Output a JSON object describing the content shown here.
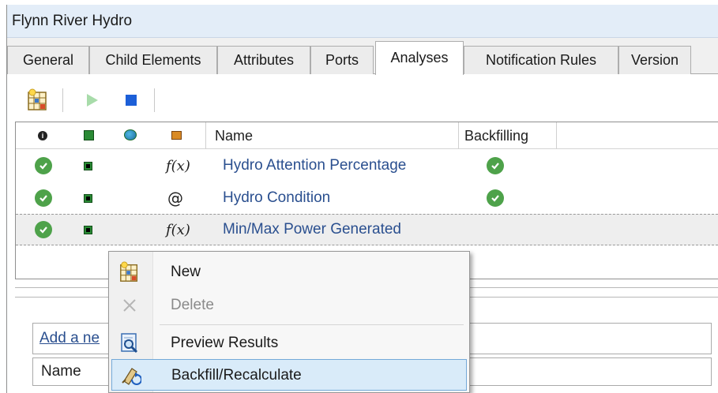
{
  "window": {
    "title": "Flynn River Hydro"
  },
  "tabs": [
    {
      "label": "General",
      "active": false
    },
    {
      "label": "Child Elements",
      "active": false
    },
    {
      "label": "Attributes",
      "active": false
    },
    {
      "label": "Ports",
      "active": false
    },
    {
      "label": "Analyses",
      "active": true
    },
    {
      "label": "Notification Rules",
      "active": false
    },
    {
      "label": "Version",
      "active": false
    }
  ],
  "toolbar": {
    "buttons": [
      {
        "icon": "new-analysis-icon",
        "enabled": true
      },
      {
        "icon": "play-icon",
        "enabled": false
      },
      {
        "icon": "stop-icon",
        "enabled": true
      }
    ]
  },
  "analyses_grid": {
    "header_icons": [
      "info-icon",
      "status-icon",
      "globe-icon",
      "type-icon"
    ],
    "columns": {
      "name": "Name",
      "backfilling": "Backfilling"
    },
    "rows": [
      {
        "status": "check-icon",
        "type": "fx",
        "name": "Hydro Attention Percentage",
        "backfilling": true
      },
      {
        "status": "check-icon",
        "type": "event",
        "name": "Hydro Condition",
        "backfilling": true
      },
      {
        "status": "check-icon",
        "type": "fx",
        "name": "Min/Max Power Generated",
        "backfilling": false
      }
    ],
    "type_glyphs": {
      "fx": "f(x)",
      "event": "@"
    }
  },
  "lower_panel": {
    "add_placeholder": "Add a ne",
    "name_header": "Name"
  },
  "context_menu": {
    "items": [
      {
        "label": "New",
        "icon": "new-analysis-icon",
        "enabled": true,
        "highlighted": false
      },
      {
        "label": "Delete",
        "icon": "delete-icon",
        "enabled": false,
        "highlighted": false
      },
      {
        "label": "Preview Results",
        "icon": "preview-icon",
        "enabled": true,
        "highlighted": false
      },
      {
        "label": "Backfill/Recalculate",
        "icon": "backfill-icon",
        "enabled": true,
        "highlighted": true
      }
    ]
  },
  "colors": {
    "accent_link": "#2a4f8f",
    "check_green": "#4ea24a",
    "highlight": "#d9ebf9"
  }
}
